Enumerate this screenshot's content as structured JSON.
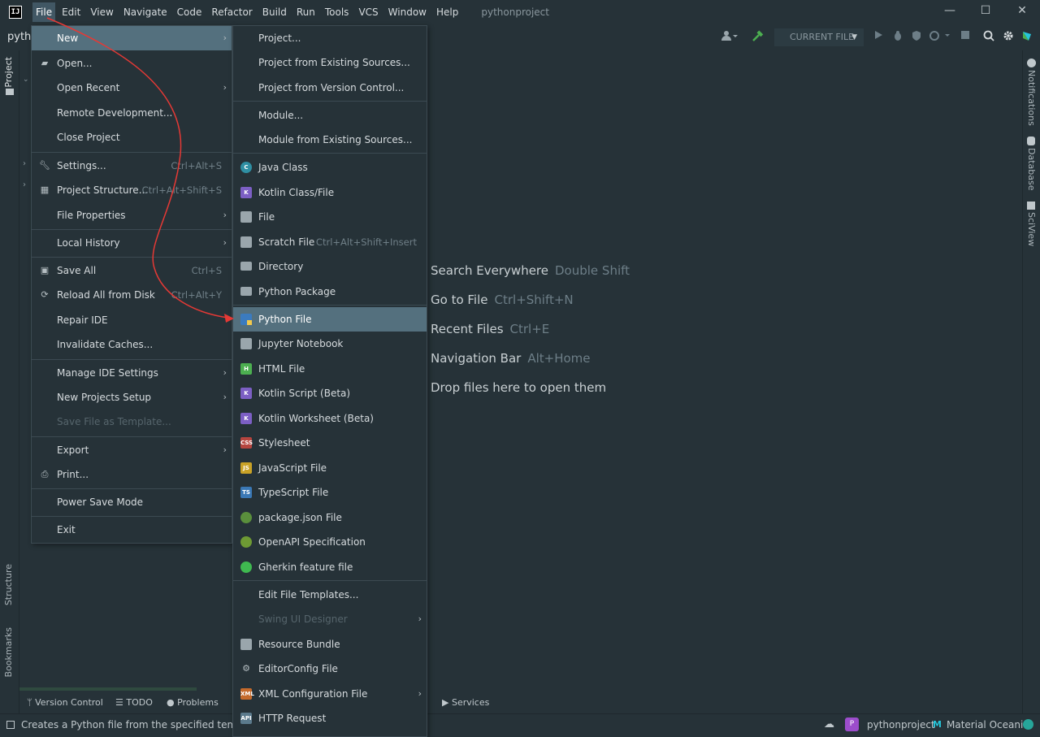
{
  "titlebar": {
    "menus": [
      "File",
      "Edit",
      "View",
      "Navigate",
      "Code",
      "Refactor",
      "Build",
      "Run",
      "Tools",
      "VCS",
      "Window",
      "Help"
    ],
    "project": "pythonproject",
    "minimize": "—",
    "maximize": "☐",
    "close": "✕"
  },
  "toolbar": {
    "project_label": "pytho",
    "run_config": "CURRENT FILE"
  },
  "left_stripe": {
    "project": "Project",
    "structure": "Structure",
    "bookmarks": "Bookmarks"
  },
  "right_stripe": {
    "notifications": "Notifications",
    "database": "Database",
    "sciview": "SciView"
  },
  "file_menu": {
    "new": "New",
    "open": "Open...",
    "open_recent": "Open Recent",
    "remote_dev": "Remote Development...",
    "close_project": "Close Project",
    "settings": "Settings...",
    "settings_sc": "Ctrl+Alt+S",
    "project_structure": "Project Structure...",
    "project_structure_sc": "Ctrl+Alt+Shift+S",
    "file_properties": "File Properties",
    "local_history": "Local History",
    "save_all": "Save All",
    "save_all_sc": "Ctrl+S",
    "reload": "Reload All from Disk",
    "reload_sc": "Ctrl+Alt+Y",
    "repair": "Repair IDE",
    "invalidate": "Invalidate Caches...",
    "manage_settings": "Manage IDE Settings",
    "new_projects_setup": "New Projects Setup",
    "save_template": "Save File as Template...",
    "export": "Export",
    "print": "Print...",
    "power_save": "Power Save Mode",
    "exit": "Exit"
  },
  "new_menu": {
    "project": "Project...",
    "project_existing": "Project from Existing Sources...",
    "project_vcs": "Project from Version Control...",
    "module": "Module...",
    "module_existing": "Module from Existing Sources...",
    "java_class": "Java Class",
    "kotlin_class": "Kotlin Class/File",
    "file": "File",
    "scratch": "Scratch File",
    "scratch_sc": "Ctrl+Alt+Shift+Insert",
    "directory": "Directory",
    "python_package": "Python Package",
    "python_file": "Python File",
    "jupyter": "Jupyter Notebook",
    "html": "HTML File",
    "kotlin_script": "Kotlin Script (Beta)",
    "kotlin_worksheet": "Kotlin Worksheet (Beta)",
    "stylesheet": "Stylesheet",
    "javascript": "JavaScript File",
    "typescript": "TypeScript File",
    "package_json": "package.json File",
    "openapi": "OpenAPI Specification",
    "gherkin": "Gherkin feature file",
    "edit_templates": "Edit File Templates...",
    "swing": "Swing UI Designer",
    "resource_bundle": "Resource Bundle",
    "editorconfig": "EditorConfig File",
    "xml_config": "XML Configuration File",
    "http_request": "HTTP Request"
  },
  "editor_hints": [
    {
      "label": "Search Everywhere",
      "key": "Double Shift"
    },
    {
      "label": "Go to File",
      "key": "Ctrl+Shift+N"
    },
    {
      "label": "Recent Files",
      "key": "Ctrl+E"
    },
    {
      "label": "Navigation Bar",
      "key": "Alt+Home"
    },
    {
      "label": "Drop files here to open them",
      "key": ""
    }
  ],
  "bottom_tabs": {
    "version_control": "Version Control",
    "todo": "TODO",
    "problems": "Problems",
    "services": "Services"
  },
  "status": {
    "text": "Creates a Python file from the specified template",
    "project": "pythonproject",
    "project_avatar": "P",
    "theme": "Material Oceanic"
  },
  "colors": {
    "background": "#263238",
    "selection": "#54707e",
    "accent_green": "#4caf50",
    "annotation_red": "#e53935"
  }
}
